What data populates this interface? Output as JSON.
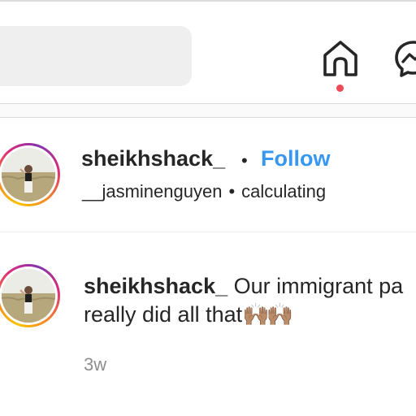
{
  "top_bar": {
    "search_placeholder": "",
    "home_icon": "home-icon",
    "messenger_icon": "messenger-icon",
    "active_indicator_color": "#ed4956"
  },
  "post": {
    "username": "sheikhshack_",
    "separator": "•",
    "follow_label": "Follow",
    "tagged_user": "__jasminenguyen",
    "sub_separator": "•",
    "location": "calculating"
  },
  "comment": {
    "username": "sheikhshack_",
    "text_line1": "Our immigrant pa",
    "text_line2": "really did all that",
    "emoji": "🙌🏽🙌🏽",
    "time": "3w"
  },
  "colors": {
    "link_blue": "#3897f0",
    "text": "#262626",
    "muted": "#8e8e8e",
    "story_ring": [
      "#f9c300",
      "#f58529",
      "#dd2a7b",
      "#8134af"
    ]
  }
}
